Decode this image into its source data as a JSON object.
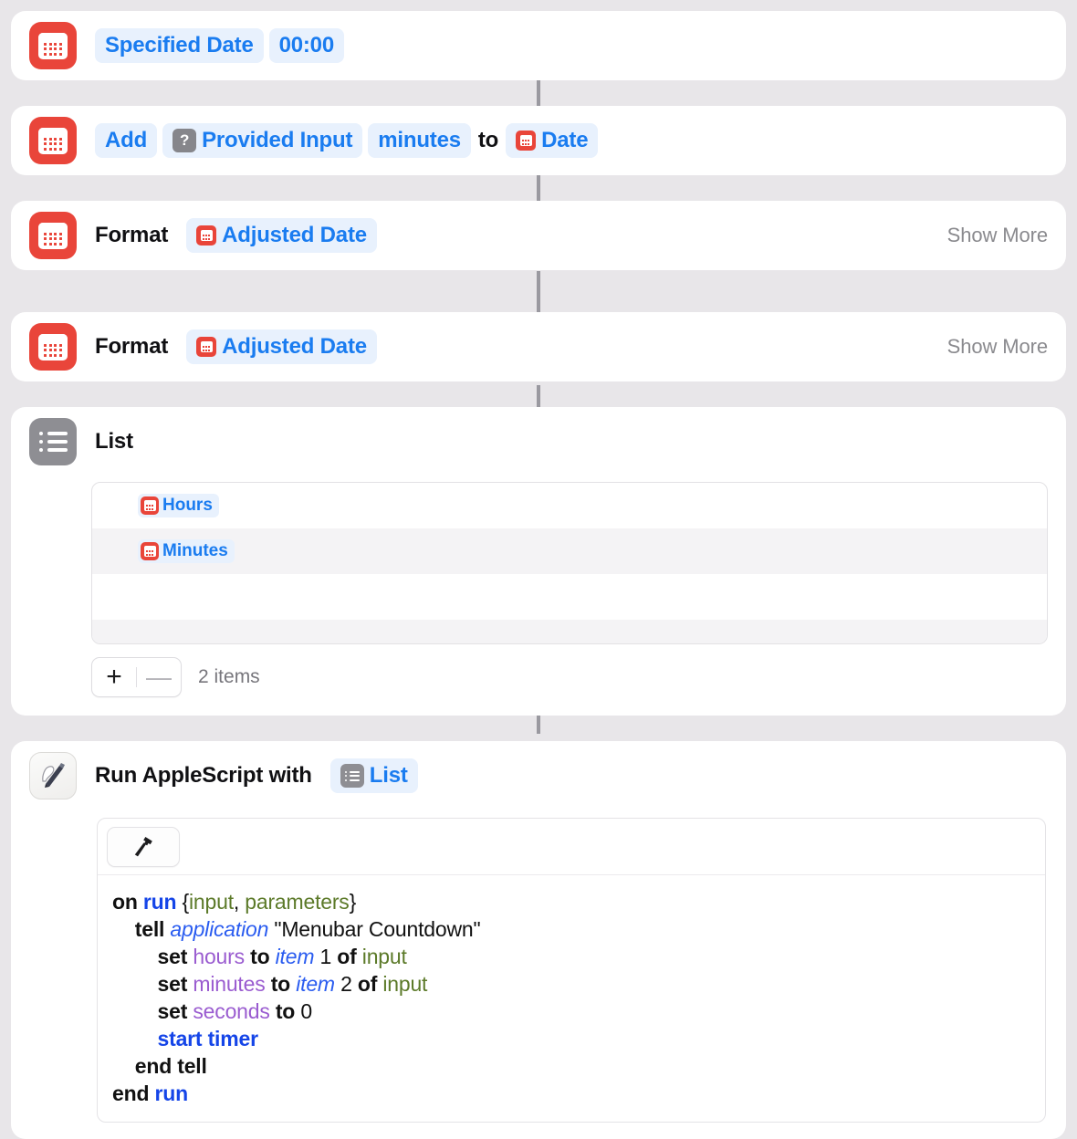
{
  "actions": [
    {
      "id": "specified-date",
      "icon": "calendar-icon",
      "tokens": [
        {
          "type": "pill",
          "label": "Specified Date"
        },
        {
          "type": "pill",
          "label": "00:00"
        }
      ]
    },
    {
      "id": "add-to-date",
      "icon": "calendar-icon",
      "tokens": [
        {
          "type": "pill",
          "label": "Add"
        },
        {
          "type": "pill-question",
          "label": "Provided Input"
        },
        {
          "type": "pill",
          "label": "minutes"
        },
        {
          "type": "word",
          "label": "to"
        },
        {
          "type": "pill-calendar",
          "label": "Date"
        }
      ]
    },
    {
      "id": "format-date-1",
      "icon": "calendar-icon",
      "title": "Format",
      "variable": "Adjusted Date",
      "show_more": "Show More"
    },
    {
      "id": "format-date-2",
      "icon": "calendar-icon",
      "title": "Format",
      "variable": "Adjusted Date",
      "show_more": "Show More"
    }
  ],
  "list_action": {
    "title": "List",
    "icon": "list-icon",
    "items": [
      {
        "label": "Hours"
      },
      {
        "label": "Minutes"
      },
      {
        "label": ""
      }
    ],
    "add_label": "+",
    "remove_label": "—",
    "count_label": "2 items"
  },
  "script_action": {
    "icon": "script-editor-icon",
    "title_prefix": "Run AppleScript with",
    "input_token": "List",
    "toolbar": {
      "hammer_label": "hammer-icon"
    },
    "code_lines": [
      {
        "indent": 0,
        "parts": [
          {
            "t": "on ",
            "c": "kw"
          },
          {
            "t": "run ",
            "c": "blue"
          },
          {
            "t": "{",
            "c": "str"
          },
          {
            "t": "input",
            "c": "grn"
          },
          {
            "t": ", ",
            "c": "str"
          },
          {
            "t": "parameters",
            "c": "grn"
          },
          {
            "t": "}",
            "c": "str"
          }
        ]
      },
      {
        "indent": 1,
        "parts": [
          {
            "t": "tell ",
            "c": "kw"
          },
          {
            "t": "application",
            "c": "ital"
          },
          {
            "t": " \"Menubar Countdown\"",
            "c": "str"
          }
        ]
      },
      {
        "indent": 2,
        "parts": [
          {
            "t": "set ",
            "c": "kw"
          },
          {
            "t": "hours",
            "c": "pur"
          },
          {
            "t": " to ",
            "c": "kw"
          },
          {
            "t": "item",
            "c": "ital"
          },
          {
            "t": " 1",
            "c": "num"
          },
          {
            "t": " of ",
            "c": "kw"
          },
          {
            "t": "input",
            "c": "grn"
          }
        ]
      },
      {
        "indent": 2,
        "parts": [
          {
            "t": "set ",
            "c": "kw"
          },
          {
            "t": "minutes",
            "c": "pur"
          },
          {
            "t": " to ",
            "c": "kw"
          },
          {
            "t": "item",
            "c": "ital"
          },
          {
            "t": " 2",
            "c": "num"
          },
          {
            "t": " of ",
            "c": "kw"
          },
          {
            "t": "input",
            "c": "grn"
          }
        ]
      },
      {
        "indent": 2,
        "parts": [
          {
            "t": "set ",
            "c": "kw"
          },
          {
            "t": "seconds",
            "c": "pur"
          },
          {
            "t": " to ",
            "c": "kw"
          },
          {
            "t": "0",
            "c": "num"
          }
        ]
      },
      {
        "indent": 2,
        "parts": [
          {
            "t": "start timer",
            "c": "blue"
          }
        ]
      },
      {
        "indent": 1,
        "parts": [
          {
            "t": "end tell",
            "c": "kw"
          }
        ]
      },
      {
        "indent": 0,
        "parts": [
          {
            "t": "end ",
            "c": "kw"
          },
          {
            "t": "run",
            "c": "blue"
          }
        ]
      }
    ]
  },
  "colors": {
    "background": "#e8e6e9",
    "card": "#ffffff",
    "accent_blue": "#1a7cf0",
    "token_bg": "#e8f1fd",
    "calendar_red": "#e9453a",
    "list_gray": "#8e8e93",
    "connector": "#9a99a0",
    "muted_text": "#8a8a8e"
  }
}
